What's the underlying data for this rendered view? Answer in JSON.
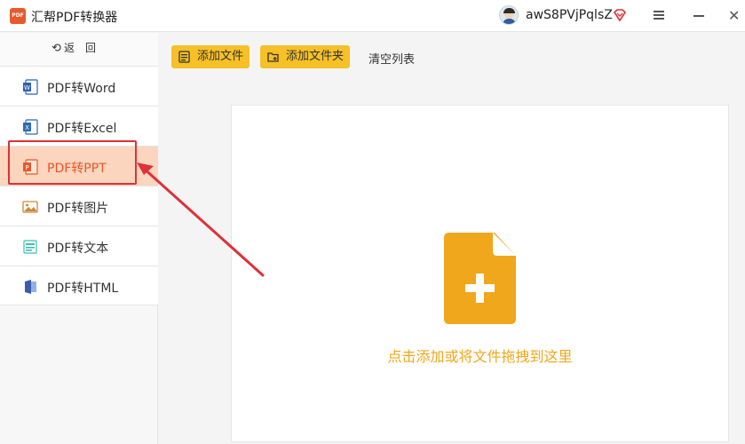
{
  "app": {
    "logo_text": "PDF",
    "title": "汇帮PDF转换器",
    "username": "awS8PVjPqlsZ"
  },
  "window_controls": {
    "menu_icon": "menu-icon",
    "minimize_icon": "minimize-icon",
    "close_icon": "close-icon",
    "close_glyph": "✕"
  },
  "sidebar": {
    "back": {
      "arrow": "⟲",
      "label": "返回"
    },
    "items": [
      {
        "label": "PDF转Word",
        "icon": "word-icon",
        "active": false
      },
      {
        "label": "PDF转Excel",
        "icon": "excel-icon",
        "active": false
      },
      {
        "label": "PDF转PPT",
        "icon": "ppt-icon",
        "active": true
      },
      {
        "label": "PDF转图片",
        "icon": "image-icon",
        "active": false
      },
      {
        "label": "PDF转文本",
        "icon": "text-icon",
        "active": false
      },
      {
        "label": "PDF转HTML",
        "icon": "html-icon",
        "active": false
      }
    ]
  },
  "toolbar": {
    "add_file_label": "添加文件",
    "add_folder_label": "添加文件夹",
    "clear_list_label": "清空列表"
  },
  "dropzone": {
    "hint": "点击添加或将文件拖拽到这里"
  },
  "colors": {
    "accent": "#f6c026",
    "active_bg": "#fbd5bd",
    "active_text": "#e8562b",
    "annotation_red": "#e0303a",
    "file_icon": "#f0a71c"
  }
}
